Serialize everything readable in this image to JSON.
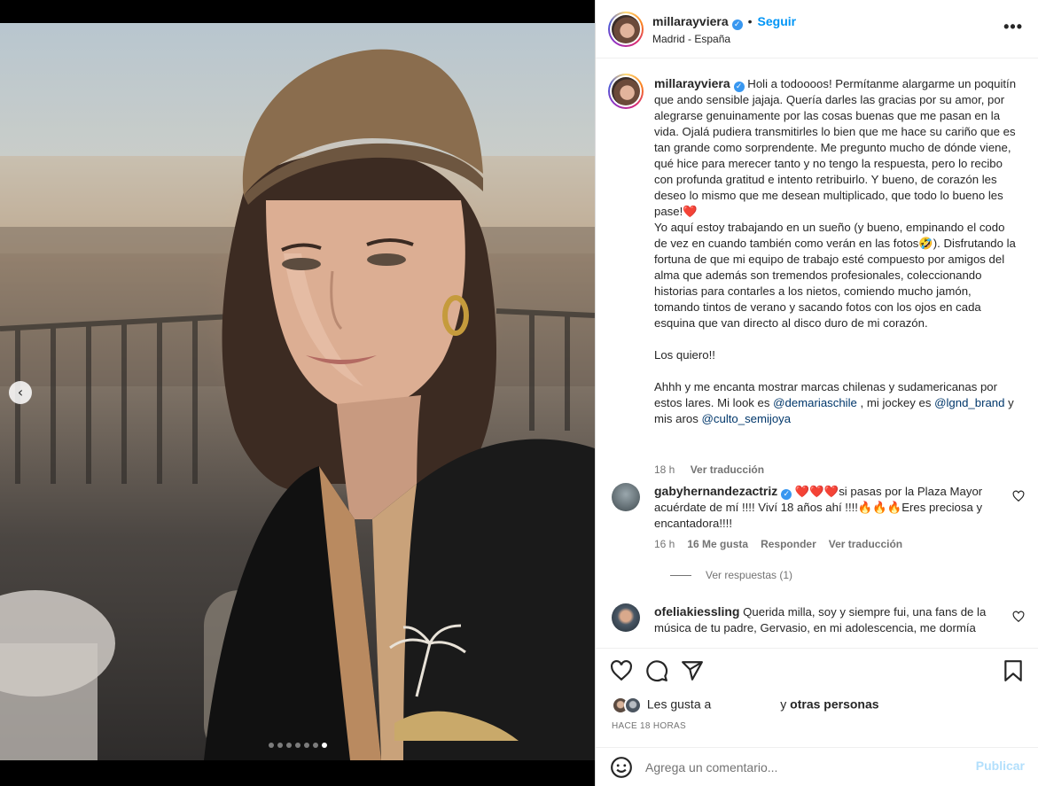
{
  "post": {
    "username": "millarayviera",
    "separator": "•",
    "follow_label": "Seguir",
    "location": "Madrid - España",
    "more_label": "•••",
    "carousel": {
      "slides": 7,
      "active_slide": 7,
      "prev_arrow": "‹"
    }
  },
  "caption": {
    "username": "millarayviera",
    "p1": "Holi a todoooos! Permítanme alargarme un poquitín que ando sensible jajaja. Quería darles las gracias por su amor, por alegrarse genuinamente por las cosas buenas que me pasan en la vida. Ojalá pudiera transmitirles lo bien que me hace su cariño que es tan grande como sorprendente. Me pregunto mucho de dónde viene, qué hice para merecer tanto y no tengo la respuesta, pero lo recibo con profunda gratitud e intento retribuirlo. Y bueno, de corazón les deseo lo mismo que me desean multiplicado, que todo lo bueno les pase!❤️",
    "p2": "Yo aquí estoy trabajando en un sueño (y bueno, empinando el codo de vez en cuando también como verán en las fotos🤣). Disfrutando la fortuna de que mi equipo de trabajo esté compuesto por amigos del alma que además son tremendos profesionales, coleccionando historias para contarles a los nietos, comiendo mucho jamón, tomando tintos de verano y sacando fotos con los ojos en cada esquina que van directo al disco duro de mi corazón.",
    "p3": "Los quiero!!",
    "p4_start": "Ahhh y me encanta mostrar marcas chilenas y sudamericanas por estos lares. Mi look es ",
    "mention1": "@demariaschile",
    "p4_mid1": " , mi jockey es ",
    "mention2": "@lgnd_brand",
    "p4_mid2": " y mis aros ",
    "mention3": "@culto_semijoya",
    "time": "18 h",
    "see_translation": "Ver traducción"
  },
  "comments": [
    {
      "username": "gabyhernandezactriz",
      "text": " ❤️❤️❤️si pasas por la Plaza Mayor acuérdate de mí !!!! Viví 18 años ahí !!!!🔥🔥🔥Eres preciosa y encantadora!!!!",
      "time": "16 h",
      "likes": "16 Me gusta",
      "reply": "Responder",
      "see_translation": "Ver traducción",
      "view_replies": "Ver respuestas (1)"
    },
    {
      "username": "ofeliakiessling",
      "text": " Querida milla, soy y siempre fui, una fans de la música de tu padre, Gervasio, en mi adolescencia, me dormía"
    }
  ],
  "likes": {
    "prefix": "Les gusta a",
    "suffix_pre": "y ",
    "suffix_bold": "otras personas"
  },
  "time_ago": "HACE 18 HORAS",
  "composer": {
    "placeholder": "Agrega un comentario...",
    "publish_label": "Publicar"
  }
}
